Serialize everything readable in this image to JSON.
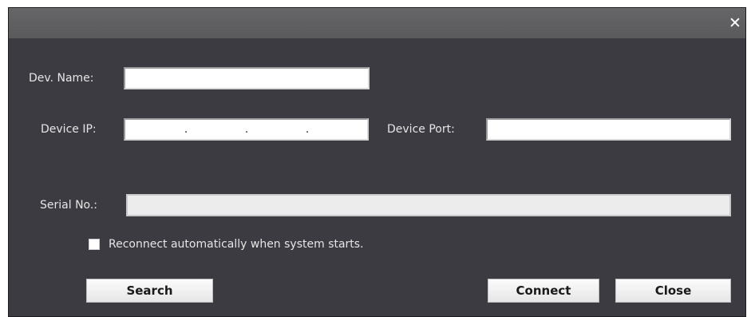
{
  "window": {
    "close_glyph": "✕"
  },
  "form": {
    "dev_name": {
      "label": "Dev. Name:",
      "value": ""
    },
    "device_ip": {
      "label": "Device IP:",
      "octets": [
        "",
        "",
        "",
        ""
      ],
      "separator": "."
    },
    "device_port": {
      "label": "Device Port:",
      "value": ""
    },
    "serial_no": {
      "label": "Serial No.:",
      "value": ""
    },
    "reconnect": {
      "label": "Reconnect automatically when system starts.",
      "checked": false
    }
  },
  "buttons": {
    "search": "Search",
    "connect": "Connect",
    "close": "Close"
  },
  "colors": {
    "dialog_bg": "#3b3b41",
    "titlebar_bg": "#5f5f61",
    "label_text": "#e6e6e6"
  }
}
